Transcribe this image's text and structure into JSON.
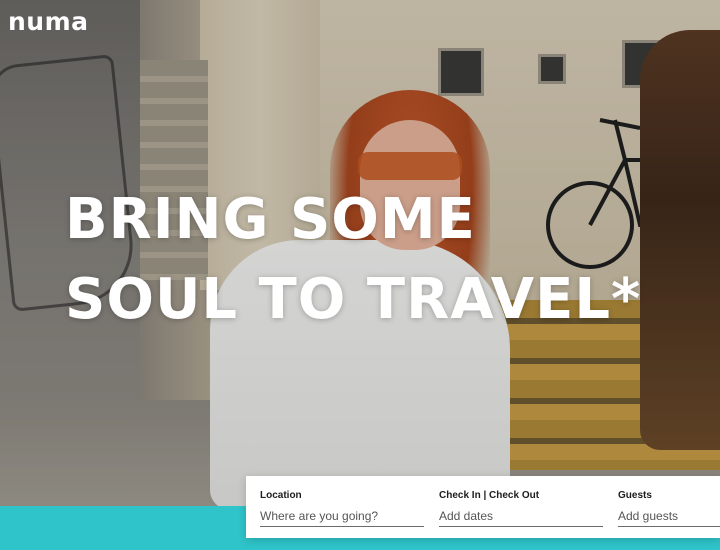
{
  "brand": {
    "logo_text": "numa",
    "accent_color": "#2ec4c9"
  },
  "hero": {
    "headline_line1": "BRING SOME",
    "headline_line2": "SOUL TO TRAVEL*"
  },
  "search": {
    "location_label": "Location",
    "location_placeholder": "Where are you going?",
    "dates_label": "Check In | Check Out",
    "dates_placeholder": "Add dates",
    "guests_label": "Guests",
    "guests_placeholder": "Add guests"
  }
}
